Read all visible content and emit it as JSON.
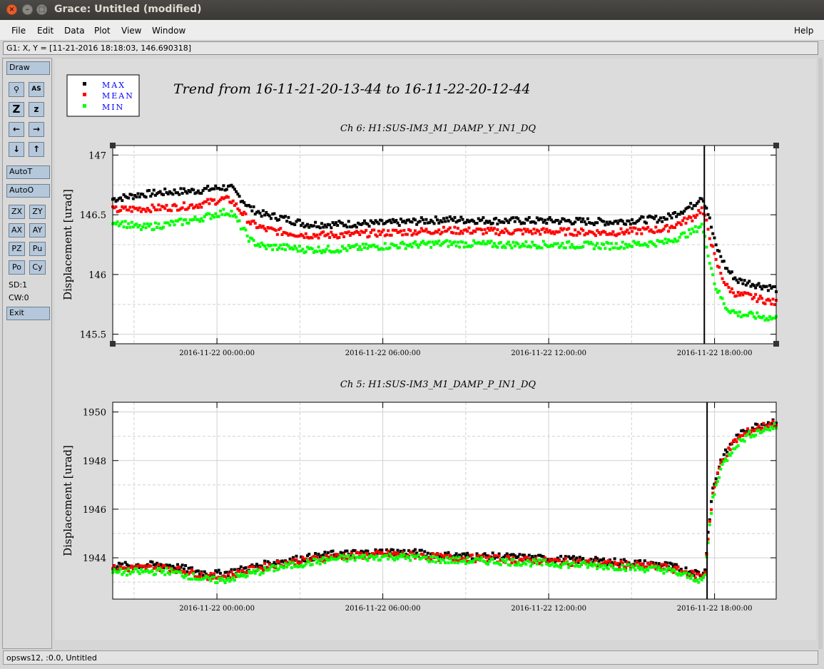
{
  "window": {
    "title": "Grace: Untitled (modified)",
    "close_glyph": "×",
    "minimize_glyph": "–",
    "maximize_glyph": "□"
  },
  "menu": {
    "file": "File",
    "edit": "Edit",
    "data": "Data",
    "plot": "Plot",
    "view": "View",
    "window": "Window",
    "help": "Help"
  },
  "locator": "G1: X, Y = [11-21-2016 18:18:03, 146.690318]",
  "toolbar": {
    "draw": "Draw",
    "zoom_glyph": "🔍",
    "autoscale_glyph": "AS",
    "zoom_z": "Z",
    "zoom_z_small": "z",
    "left": "←",
    "right": "→",
    "down": "↓",
    "up": "↑",
    "autot": "AutoT",
    "autoo": "AutoO",
    "zx": "ZX",
    "zy": "ZY",
    "ax": "AX",
    "ay": "AY",
    "pz": "PZ",
    "pu": "Pu",
    "po": "Po",
    "cy": "Cy",
    "sd": "SD:1",
    "cw": "CW:0",
    "exit": "Exit"
  },
  "status": "opsws12, :0.0, Untitled",
  "colors": {
    "max": "#000000",
    "mean": "#ff0000",
    "min": "#00ff00",
    "legend_text": "#0000ff"
  },
  "chart_data": [
    {
      "type": "scatter",
      "title": "Trend from 16-11-21-20-13-44 to 16-11-22-20-12-44",
      "subtitle": "Ch 6: H1:SUS-IM3_M1_DAMP_Y_IN1_DQ",
      "ylabel": "Displacement [urad]",
      "xlabel": "",
      "x_ticks": [
        "2016-11-22 00:00:00",
        "2016-11-22 06:00:00",
        "2016-11-22 12:00:00",
        "2016-11-22 18:00:00"
      ],
      "x_tick_hours": [
        3.77,
        9.77,
        15.77,
        21.77
      ],
      "xlim_hours": [
        0,
        24
      ],
      "y_ticks": [
        145.5,
        146,
        146.5,
        147
      ],
      "ylim": [
        145.42,
        147.08
      ],
      "grid": true,
      "legend": [
        "MAX",
        "MEAN",
        "MIN"
      ],
      "legend_position": "top-left",
      "marker_hour": 21.4,
      "series": [
        {
          "name": "MAX",
          "hours": [
            0,
            1,
            2,
            3,
            4,
            4.3,
            5,
            5.5,
            6,
            7,
            8,
            10,
            12,
            14,
            16,
            18,
            20,
            21,
            21.3,
            21.5,
            21.8,
            22.2,
            22.6,
            23,
            24
          ],
          "values": [
            146.63,
            146.67,
            146.69,
            146.7,
            146.73,
            146.72,
            146.55,
            146.5,
            146.48,
            146.42,
            146.42,
            146.43,
            146.46,
            146.45,
            146.45,
            146.44,
            146.47,
            146.58,
            146.66,
            146.55,
            146.25,
            146.05,
            145.95,
            145.93,
            145.88
          ]
        },
        {
          "name": "MEAN",
          "hours": [
            0,
            1,
            2,
            3,
            4,
            4.3,
            5,
            5.5,
            6,
            7,
            8,
            10,
            12,
            14,
            16,
            18,
            20,
            21,
            21.3,
            21.5,
            21.8,
            22.2,
            22.6,
            23,
            24
          ],
          "values": [
            146.54,
            146.55,
            146.56,
            146.58,
            146.63,
            146.62,
            146.43,
            146.38,
            146.36,
            146.33,
            146.33,
            146.35,
            146.37,
            146.36,
            146.36,
            146.35,
            146.38,
            146.48,
            146.55,
            146.42,
            146.12,
            145.9,
            145.83,
            145.82,
            145.76
          ]
        },
        {
          "name": "MIN",
          "hours": [
            0,
            1,
            2,
            3,
            4,
            4.3,
            5,
            5.5,
            6,
            7,
            8,
            10,
            12,
            14,
            16,
            18,
            20,
            21,
            21.3,
            21.5,
            21.8,
            22.2,
            22.6,
            23,
            24
          ],
          "values": [
            146.45,
            146.39,
            146.42,
            146.46,
            146.52,
            146.52,
            146.28,
            146.23,
            146.23,
            146.21,
            146.21,
            146.24,
            146.26,
            146.25,
            146.25,
            146.24,
            146.27,
            146.36,
            146.42,
            146.22,
            145.9,
            145.72,
            145.67,
            145.66,
            145.63
          ]
        }
      ]
    },
    {
      "type": "scatter",
      "subtitle": "Ch 5: H1:SUS-IM3_M1_DAMP_P_IN1_DQ",
      "ylabel": "Displacement [urad]",
      "xlabel": "",
      "x_ticks": [
        "2016-11-22 00:00:00",
        "2016-11-22 06:00:00",
        "2016-11-22 12:00:00",
        "2016-11-22 18:00:00"
      ],
      "x_tick_hours": [
        3.77,
        9.77,
        15.77,
        21.77
      ],
      "xlim_hours": [
        0,
        24
      ],
      "y_ticks": [
        1944,
        1946,
        1948,
        1950
      ],
      "ylim": [
        1942.3,
        1950.4
      ],
      "grid": true,
      "marker_hour": 21.5,
      "series": [
        {
          "name": "MAX",
          "hours": [
            0,
            1,
            2,
            3,
            3.5,
            4,
            5,
            6,
            7,
            8,
            10,
            11,
            12,
            14,
            16,
            18,
            20,
            21.4,
            21.55,
            21.7,
            22,
            22.5,
            23,
            23.5,
            24
          ],
          "values": [
            1943.65,
            1943.7,
            1943.7,
            1943.45,
            1943.35,
            1943.35,
            1943.6,
            1943.85,
            1944.0,
            1944.15,
            1944.25,
            1944.2,
            1944.1,
            1944.05,
            1943.95,
            1943.85,
            1943.7,
            1943.3,
            1945.2,
            1946.8,
            1948.0,
            1948.9,
            1949.3,
            1949.5,
            1949.65
          ]
        },
        {
          "name": "MEAN",
          "hours": [
            0,
            1,
            2,
            3,
            3.5,
            4,
            5,
            6,
            7,
            8,
            10,
            11,
            12,
            14,
            16,
            18,
            20,
            21.4,
            21.55,
            21.7,
            22,
            22.5,
            23,
            23.5,
            24
          ],
          "values": [
            1943.55,
            1943.58,
            1943.6,
            1943.35,
            1943.22,
            1943.22,
            1943.5,
            1943.75,
            1943.9,
            1944.05,
            1944.15,
            1944.1,
            1944.0,
            1943.95,
            1943.85,
            1943.75,
            1943.6,
            1943.2,
            1945.0,
            1946.6,
            1947.9,
            1948.8,
            1949.2,
            1949.4,
            1949.55
          ]
        },
        {
          "name": "MIN",
          "hours": [
            0,
            1,
            2,
            3,
            3.5,
            4,
            5,
            6,
            7,
            8,
            10,
            11,
            12,
            14,
            16,
            18,
            20,
            21.4,
            21.55,
            21.7,
            22,
            22.5,
            23,
            23.5,
            24
          ],
          "values": [
            1943.4,
            1943.42,
            1943.45,
            1943.2,
            1943.08,
            1943.08,
            1943.35,
            1943.6,
            1943.78,
            1943.95,
            1944.05,
            1944.0,
            1943.9,
            1943.85,
            1943.75,
            1943.65,
            1943.5,
            1943.05,
            1944.8,
            1946.4,
            1947.7,
            1948.6,
            1949.05,
            1949.25,
            1949.4
          ]
        }
      ]
    }
  ]
}
